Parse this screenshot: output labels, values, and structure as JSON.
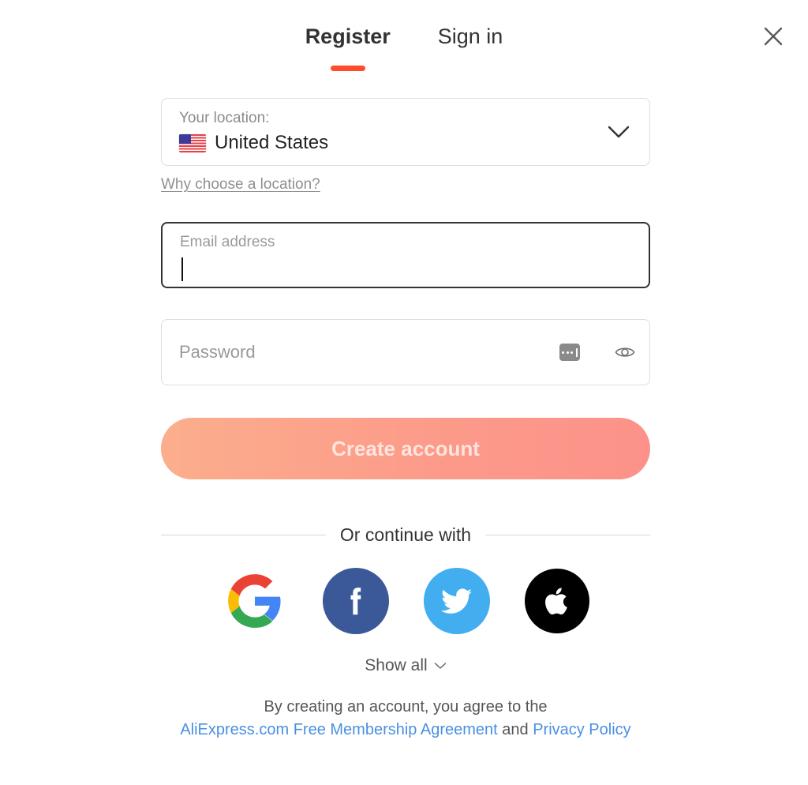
{
  "modal": {
    "close_icon": "close-icon"
  },
  "tabs": [
    {
      "label": "Register",
      "active": true
    },
    {
      "label": "Sign in",
      "active": false
    }
  ],
  "location": {
    "label": "Your location:",
    "value": "United States",
    "flag": "us-flag-icon",
    "chevron_icon": "chevron-down-icon",
    "help_link": "Why choose a location?"
  },
  "email": {
    "label": "Email address",
    "value": "",
    "focused": true
  },
  "password": {
    "placeholder": "Password",
    "value": "",
    "manager_icon": "password-manager-icon",
    "reveal_icon": "eye-icon"
  },
  "submit": {
    "label": "Create account",
    "disabled": true
  },
  "divider": {
    "label": "Or continue with"
  },
  "social": [
    {
      "name": "google",
      "label": "Google"
    },
    {
      "name": "facebook",
      "label": "Facebook"
    },
    {
      "name": "twitter",
      "label": "Twitter"
    },
    {
      "name": "apple",
      "label": "Apple"
    }
  ],
  "show_all": {
    "label": "Show all",
    "chevron_icon": "chevron-down-icon"
  },
  "legal": {
    "line1": "By creating an account, you agree to the",
    "link1": "AliExpress.com Free Membership Agreement",
    "conjunction": " and ",
    "link2": "Privacy Policy"
  },
  "colors": {
    "accent": "#FF4B2E",
    "link": "#4A90E2",
    "button_gradient_start": "#FBAE8C",
    "button_gradient_end": "#FC9289",
    "facebook": "#3B5998",
    "twitter": "#42AEF0",
    "apple": "#000000"
  }
}
